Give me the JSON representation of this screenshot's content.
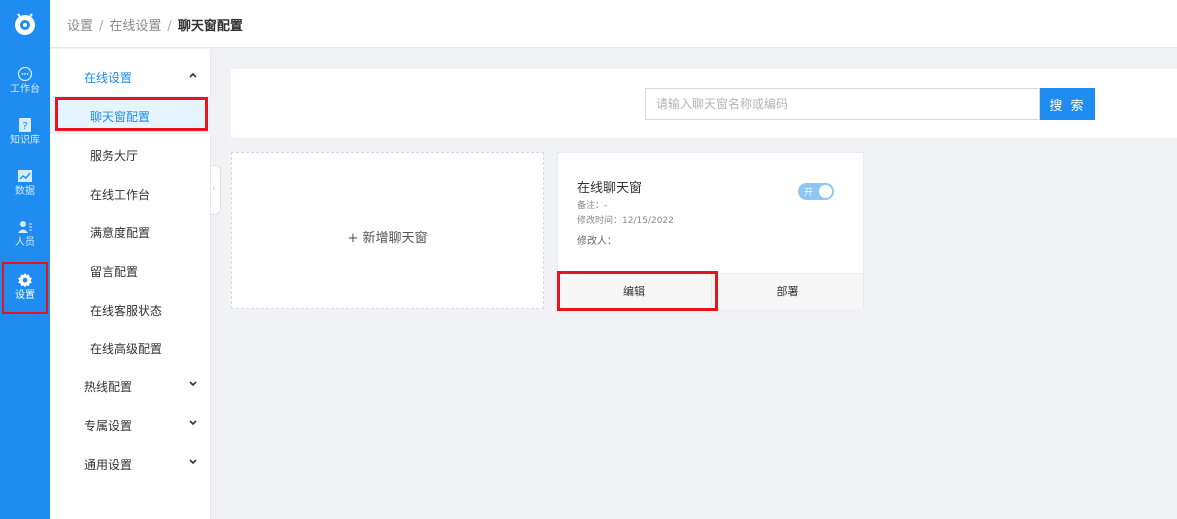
{
  "rail": {
    "logo": "mascot-logo-icon",
    "items": [
      {
        "label": "工作台",
        "icon": "chat-bubble-icon"
      },
      {
        "label": "知识库",
        "icon": "question-book-icon"
      },
      {
        "label": "数据",
        "icon": "chart-icon"
      },
      {
        "label": "人员",
        "icon": "user-list-icon"
      },
      {
        "label": "设置",
        "icon": "gear-icon",
        "active": true
      }
    ]
  },
  "breadcrumb": {
    "level1": "设置",
    "sep": "/",
    "level2": "在线设置",
    "current": "聊天窗配置"
  },
  "sidebar": {
    "groups": [
      {
        "label": "在线设置",
        "open": true,
        "items": [
          "聊天窗配置",
          "服务大厅",
          "在线工作台",
          "满意度配置",
          "留言配置",
          "在线客服状态",
          "在线高级配置"
        ]
      },
      {
        "label": "热线配置",
        "open": false
      },
      {
        "label": "专属设置",
        "open": false
      },
      {
        "label": "通用设置",
        "open": false
      }
    ]
  },
  "search": {
    "placeholder": "请输入聊天窗名称或编码",
    "button": "搜 索"
  },
  "add_card": {
    "label": "+ 新增聊天窗"
  },
  "chat_card": {
    "name": "在线聊天窗",
    "toggle_label": "开",
    "note": "备注：-",
    "modified_time": "修改时间：12/15/2022",
    "modified_by": "修改人：",
    "actions": {
      "edit": "编辑",
      "deploy": "部署"
    }
  },
  "colors": {
    "primary": "#1e8cf0",
    "highlight": "#e8141c",
    "toggle_on": "#8ec7f7"
  }
}
